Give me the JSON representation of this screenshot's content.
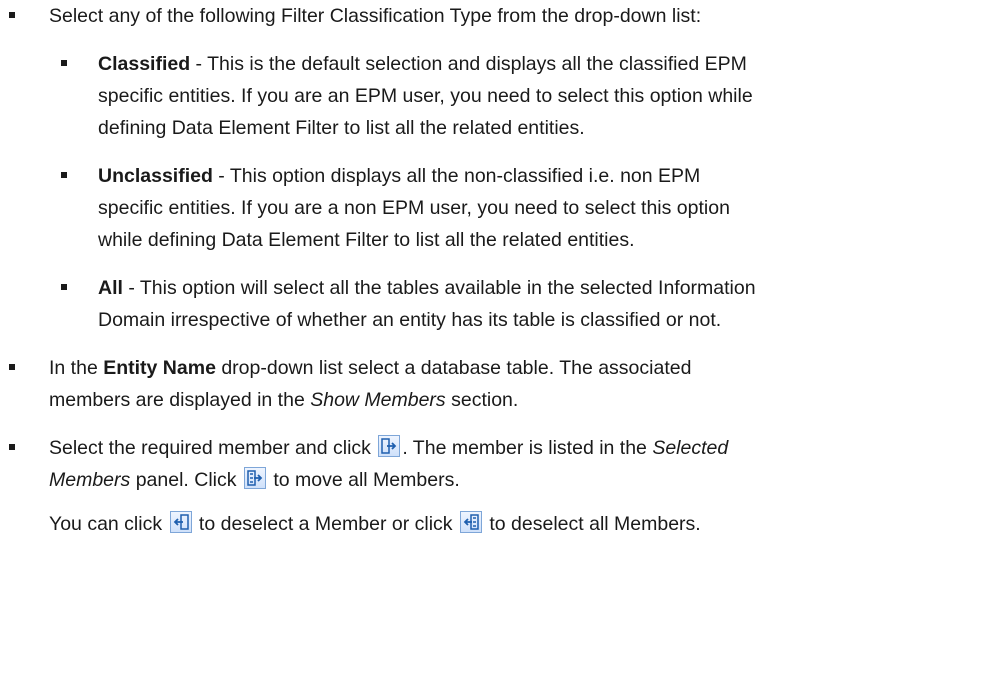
{
  "intro": "Select any of the following Filter Classification Type from the drop-down list:",
  "options": [
    {
      "name": "Classified",
      "lines": [
        " - This is the default selection and displays all the classified EPM",
        "specific entities. If you are an EPM user, you need to select this option while",
        "defining Data Element Filter to list all the related entities."
      ]
    },
    {
      "name": "Unclassified",
      "lines": [
        " - This option displays all the non-classified i.e. non EPM",
        "specific entities. If you are a non EPM user, you need to select this option",
        "while defining Data Element Filter to list all the related entities."
      ]
    },
    {
      "name": "All",
      "lines": [
        " - This option will select all the tables available in the selected Information",
        "Domain irrespective of whether an entity has its table is classified or not."
      ]
    }
  ],
  "entity": {
    "pre": "In the ",
    "bold": "Entity Name",
    "post": " drop-down list select a database table. The associated",
    "line2_pre": "members are displayed in the ",
    "line2_italic": "Show Members",
    "line2_post": " section."
  },
  "select": {
    "pre": "Select the required member and click ",
    "mid": ". The member is listed in the ",
    "italic1": "Selected",
    "italic2": "Members",
    "mid2": " panel. Click ",
    "post": " to move all Members."
  },
  "deselect": {
    "pre": "You can click ",
    "mid": " to deselect a Member or click ",
    "post": " to deselect all Members."
  },
  "icons": {
    "move_selected": "move-right-icon",
    "move_all": "move-all-right-icon",
    "deselect_one": "move-left-icon",
    "deselect_all": "move-all-left-icon"
  },
  "colors": {
    "icon_border": "#7ea6d8",
    "icon_arrow": "#1f5fae"
  }
}
